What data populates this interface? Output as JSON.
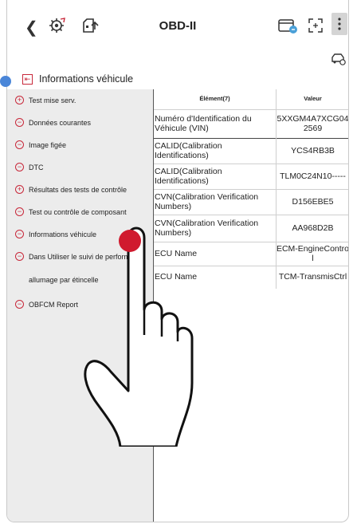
{
  "header": {
    "title": "OBD-II",
    "back_icon": "chevron-left-icon",
    "icons": [
      "gear-link-icon",
      "car-upload-icon",
      "card-icon",
      "expand-icon",
      "more-icon",
      "car-settings-icon"
    ]
  },
  "section": {
    "title": "Informations véhicule"
  },
  "menu": {
    "items": [
      {
        "label": "Test mise serv.",
        "icon": "+"
      },
      {
        "label": "Données courantes",
        "icon": "−"
      },
      {
        "label": "Image figée",
        "icon": "−"
      },
      {
        "label": "DTC",
        "icon": "−"
      },
      {
        "label": "Résultats des tests de contrôle",
        "icon": "+"
      },
      {
        "label": "Test ou contrôle de composant",
        "icon": "−"
      },
      {
        "label": "Informations véhicule",
        "icon": "−"
      },
      {
        "label": "Dans Utiliser le suivi de perform",
        "icon": "−"
      },
      {
        "label": "allumage par étincelle",
        "icon": ""
      },
      {
        "label": "OBFCM Report",
        "icon": "−"
      }
    ]
  },
  "table": {
    "col_element": "Élément(7)",
    "col_value": "Valeur",
    "rows": [
      {
        "element": "Numéro d'Identification du Véhicule (VIN)",
        "value": "5XXGM4A7XCG042569"
      },
      {
        "element": "CALID(Calibration Identifications)",
        "value": "YCS4RB3B"
      },
      {
        "element": "CALID(Calibration Identifications)",
        "value": "TLM0C24N10-----"
      },
      {
        "element": "CVN(Calibration Verification Numbers)",
        "value": "D156EBE5"
      },
      {
        "element": "CVN(Calibration Verification Numbers)",
        "value": "AA968D2B"
      },
      {
        "element": "ECU Name",
        "value": "ECM-EngineControl"
      },
      {
        "element": "ECU Name",
        "value": "TCM-TransmisCtrl"
      }
    ]
  },
  "colors": {
    "accent_red": "#c8283a",
    "indicator_blue": "#4a86d8",
    "panel_grey": "#ececec"
  }
}
